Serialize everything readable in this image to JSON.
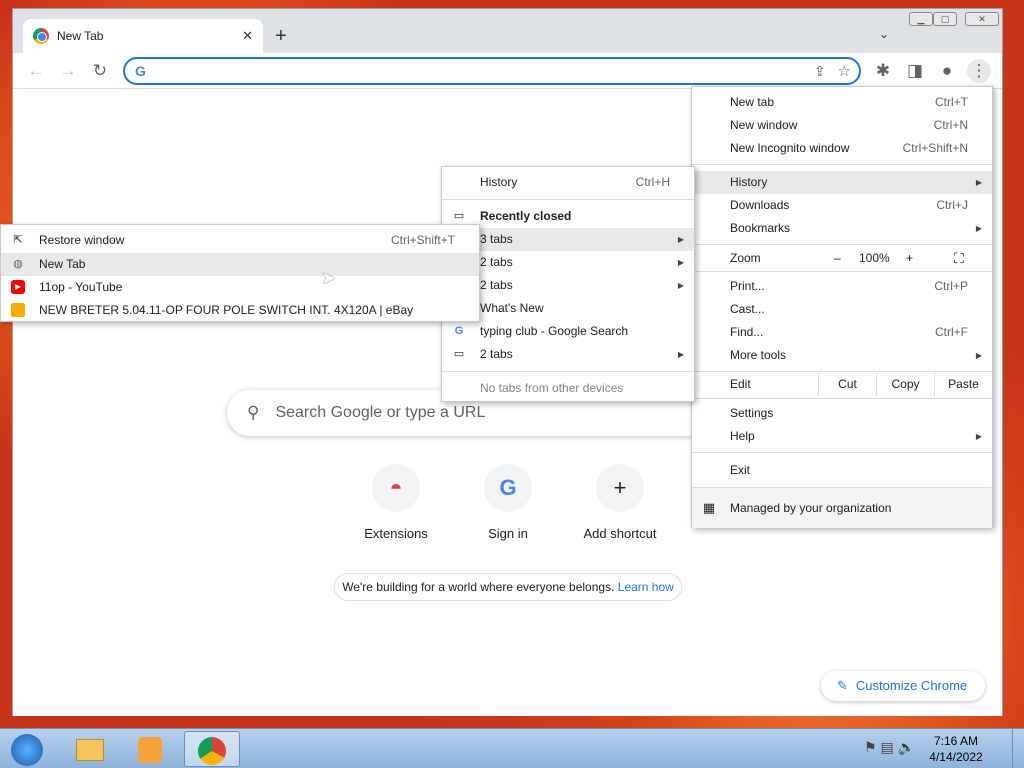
{
  "tab": {
    "title": "New Tab"
  },
  "omnibox": {
    "value": ""
  },
  "page": {
    "search_placeholder": "Search Google or type a URL",
    "shortcuts": [
      {
        "label": "Extensions",
        "icon": "chrome-web-store-icon"
      },
      {
        "label": "Sign in",
        "icon": "google-g-icon"
      },
      {
        "label": "Add shortcut",
        "icon": "plus-icon"
      }
    ],
    "banner_text": "We're building for a world where everyone belongs.",
    "banner_link": "Learn how",
    "customize_label": "Customize Chrome"
  },
  "main_menu": {
    "items": [
      {
        "label": "New tab",
        "shortcut": "Ctrl+T"
      },
      {
        "label": "New window",
        "shortcut": "Ctrl+N"
      },
      {
        "label": "New Incognito window",
        "shortcut": "Ctrl+Shift+N"
      },
      {
        "label": "History"
      },
      {
        "label": "Downloads",
        "shortcut": "Ctrl+J"
      },
      {
        "label": "Bookmarks"
      },
      {
        "label": "Print...",
        "shortcut": "Ctrl+P"
      },
      {
        "label": "Cast..."
      },
      {
        "label": "Find...",
        "shortcut": "Ctrl+F"
      },
      {
        "label": "More tools"
      },
      {
        "label": "Settings"
      },
      {
        "label": "Help"
      },
      {
        "label": "Exit"
      }
    ],
    "zoom": {
      "label": "Zoom",
      "minus": "–",
      "value": "100%",
      "plus": "+"
    },
    "edit": {
      "label": "Edit",
      "cut": "Cut",
      "copy": "Copy",
      "paste": "Paste"
    },
    "managed": "Managed by your organization"
  },
  "history_menu": {
    "history": {
      "label": "History",
      "shortcut": "Ctrl+H"
    },
    "recently_closed": "Recently closed",
    "items": [
      "3 tabs",
      "2 tabs",
      "2 tabs",
      "What's New",
      "typing club - Google Search",
      "2 tabs"
    ],
    "no_tabs": "No tabs from other devices"
  },
  "tabs_menu": {
    "restore": {
      "label": "Restore window",
      "shortcut": "Ctrl+Shift+T"
    },
    "items": [
      "New Tab",
      "11op - YouTube",
      "NEW BRETER 5.04.11-OP FOUR POLE SWITCH INT. 4X120A | eBay"
    ]
  },
  "taskbar": {
    "time": "7:16 AM",
    "date": "4/14/2022"
  }
}
